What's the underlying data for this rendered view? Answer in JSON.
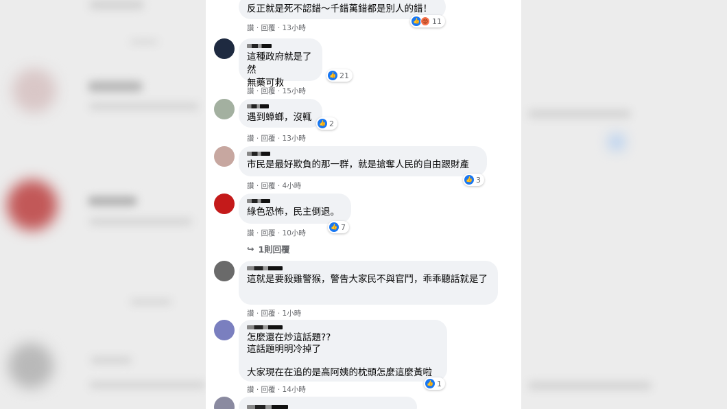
{
  "comments": [
    {
      "text": "反正就是死不認錯～千錯萬錯都是別人的錯！",
      "reaction_count": "11",
      "meta": "讚 · 回覆 · 13小時",
      "reactions": [
        "like-icon",
        "angry-icon"
      ],
      "avatar_color": "#3a3a4a"
    },
    {
      "text": "這種政府就是了然\n無藥可救",
      "reaction_count": "21",
      "meta": "讚 · 回覆 · 15小時",
      "reactions": [
        "like-icon"
      ],
      "avatar_color": "#1e2a40"
    },
    {
      "text": "遇到蟑螂，沒輒",
      "reaction_count": "2",
      "meta": "讚 · 回覆 · 13小時",
      "reactions": [
        "like-icon"
      ],
      "avatar_color": "#a3b0a0"
    },
    {
      "text": "市民是最好欺負的那一群，就是搶奪人民的自由跟財產",
      "reaction_count": "3",
      "meta": "讚 · 回覆 · 4小時",
      "reactions": [
        "like-icon"
      ],
      "avatar_color": "#c7a7a0"
    },
    {
      "text": "綠色恐怖，民主倒退。",
      "reaction_count": "7",
      "meta": "讚 · 回覆 · 10小時",
      "reactions": [
        "like-icon"
      ],
      "avatar_color": "#c41a1a"
    },
    {
      "text": "這就是要殺雞警猴，警告大家民不與官鬥，乖乖聽話就是了",
      "reaction_count": "",
      "meta": "讚 · 回覆 · 1小時",
      "reactions": [],
      "avatar_color": "#6a6a6a"
    },
    {
      "text": "怎麼還在炒這話題??\n這話題明明冷掉了\n\n大家現在在追的是高阿姨的枕頭怎麼這麼黃啦",
      "reaction_count": "1",
      "meta": "讚 · 回覆 · 14小時",
      "reactions": [
        "like-icon"
      ],
      "avatar_color": "#7a7fbf"
    }
  ],
  "reply_link": "1則回覆",
  "colors": {
    "like": "#1877f2",
    "bubble": "#f0f2f5",
    "meta_text": "#65676b"
  }
}
